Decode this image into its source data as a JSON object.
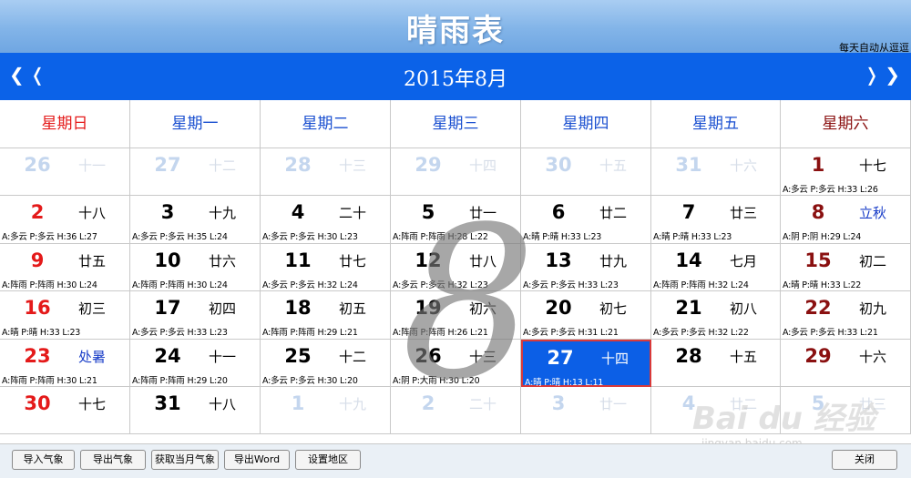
{
  "app_title": "晴雨表",
  "auto_update": "每天自动从逗逗",
  "nav": {
    "prev": "❮❬",
    "next": "❭❯",
    "month": "2015年8月"
  },
  "weekdays": [
    "星期日",
    "星期一",
    "星期二",
    "星期三",
    "星期四",
    "星期五",
    "星期六"
  ],
  "weekday_colors": [
    "#e41a1a",
    "#1a4fd0",
    "#1a4fd0",
    "#1a4fd0",
    "#1a4fd0",
    "#1a4fd0",
    "#8a1010"
  ],
  "weeks": [
    [
      {
        "day": "26",
        "lunar": "十一",
        "weather": "",
        "style": "faded"
      },
      {
        "day": "27",
        "lunar": "十二",
        "weather": "",
        "style": "faded"
      },
      {
        "day": "28",
        "lunar": "十三",
        "weather": "",
        "style": "faded"
      },
      {
        "day": "29",
        "lunar": "十四",
        "weather": "",
        "style": "faded"
      },
      {
        "day": "30",
        "lunar": "十五",
        "weather": "",
        "style": "faded"
      },
      {
        "day": "31",
        "lunar": "十六",
        "weather": "",
        "style": "faded"
      },
      {
        "day": "1",
        "lunar": "十七",
        "weather": "A:多云 P:多云 H:33 L:26",
        "style": "dred"
      }
    ],
    [
      {
        "day": "2",
        "lunar": "十八",
        "weather": "A:多云 P:多云 H:36 L:27",
        "style": "red"
      },
      {
        "day": "3",
        "lunar": "十九",
        "weather": "A:多云 P:多云 H:35 L:24",
        "style": "black"
      },
      {
        "day": "4",
        "lunar": "二十",
        "weather": "A:多云 P:多云 H:30 L:23",
        "style": "black"
      },
      {
        "day": "5",
        "lunar": "廿一",
        "weather": "A:阵雨 P:阵雨 H:28 L:22",
        "style": "black"
      },
      {
        "day": "6",
        "lunar": "廿二",
        "weather": "A:晴 P:晴 H:33 L:23",
        "style": "black"
      },
      {
        "day": "7",
        "lunar": "廿三",
        "weather": "A:晴 P:晴 H:33 L:23",
        "style": "black"
      },
      {
        "day": "8",
        "lunar": "立秋",
        "weather": "A:阴 P:阴 H:29 L:24",
        "style": "dred festival"
      }
    ],
    [
      {
        "day": "9",
        "lunar": "廿五",
        "weather": "A:阵雨 P:阵雨 H:30 L:24",
        "style": "red"
      },
      {
        "day": "10",
        "lunar": "廿六",
        "weather": "A:阵雨 P:阵雨 H:30 L:24",
        "style": "black"
      },
      {
        "day": "11",
        "lunar": "廿七",
        "weather": "A:多云 P:多云 H:32 L:24",
        "style": "black"
      },
      {
        "day": "12",
        "lunar": "廿八",
        "weather": "A:多云 P:多云 H:32 L:23",
        "style": "black"
      },
      {
        "day": "13",
        "lunar": "廿九",
        "weather": "A:多云 P:多云 H:33 L:23",
        "style": "black"
      },
      {
        "day": "14",
        "lunar": "七月",
        "weather": "A:阵雨 P:阵雨 H:32 L:24",
        "style": "black"
      },
      {
        "day": "15",
        "lunar": "初二",
        "weather": "A:晴 P:晴 H:33 L:22",
        "style": "dred"
      }
    ],
    [
      {
        "day": "16",
        "lunar": "初三",
        "weather": "A:晴 P:晴 H:33 L:23",
        "style": "red"
      },
      {
        "day": "17",
        "lunar": "初四",
        "weather": "A:多云 P:多云 H:33 L:23",
        "style": "black"
      },
      {
        "day": "18",
        "lunar": "初五",
        "weather": "A:阵雨 P:阵雨 H:29 L:21",
        "style": "black"
      },
      {
        "day": "19",
        "lunar": "初六",
        "weather": "A:阵雨 P:阵雨 H:26 L:21",
        "style": "black"
      },
      {
        "day": "20",
        "lunar": "初七",
        "weather": "A:多云 P:多云 H:31 L:21",
        "style": "black"
      },
      {
        "day": "21",
        "lunar": "初八",
        "weather": "A:多云 P:多云 H:32 L:22",
        "style": "black"
      },
      {
        "day": "22",
        "lunar": "初九",
        "weather": "A:多云 P:多云 H:33 L:21",
        "style": "dred"
      }
    ],
    [
      {
        "day": "23",
        "lunar": "处暑",
        "weather": "A:阵雨 P:阵雨 H:30 L:21",
        "style": "red festival"
      },
      {
        "day": "24",
        "lunar": "十一",
        "weather": "A:阵雨 P:阵雨 H:29 L:20",
        "style": "black"
      },
      {
        "day": "25",
        "lunar": "十二",
        "weather": "A:多云 P:多云 H:30 L:20",
        "style": "black"
      },
      {
        "day": "26",
        "lunar": "十三",
        "weather": "A:阴 P:大雨 H:30 L:20",
        "style": "black"
      },
      {
        "day": "27",
        "lunar": "十四",
        "weather": "A:晴 P:晴 H:13 L:11",
        "style": "black sel"
      },
      {
        "day": "28",
        "lunar": "十五",
        "weather": "",
        "style": "black"
      },
      {
        "day": "29",
        "lunar": "十六",
        "weather": "",
        "style": "dred"
      }
    ],
    [
      {
        "day": "30",
        "lunar": "十七",
        "weather": "",
        "style": "red"
      },
      {
        "day": "31",
        "lunar": "十八",
        "weather": "",
        "style": "black"
      },
      {
        "day": "1",
        "lunar": "十九",
        "weather": "",
        "style": "faded"
      },
      {
        "day": "2",
        "lunar": "二十",
        "weather": "",
        "style": "faded"
      },
      {
        "day": "3",
        "lunar": "廿一",
        "weather": "",
        "style": "faded"
      },
      {
        "day": "4",
        "lunar": "廿二",
        "weather": "",
        "style": "faded"
      },
      {
        "day": "5",
        "lunar": "廿三",
        "weather": "",
        "style": "faded"
      }
    ]
  ],
  "watermark_month": "8",
  "footer": {
    "import": "导入气象",
    "export": "导出气象",
    "fetch": "获取当月气象",
    "export_word": "导出Word",
    "set_region": "设置地区",
    "close": "关闭"
  },
  "baidu_watermark": {
    "logo": "Bai du 经验",
    "url": "jingyan.baidu.com"
  }
}
